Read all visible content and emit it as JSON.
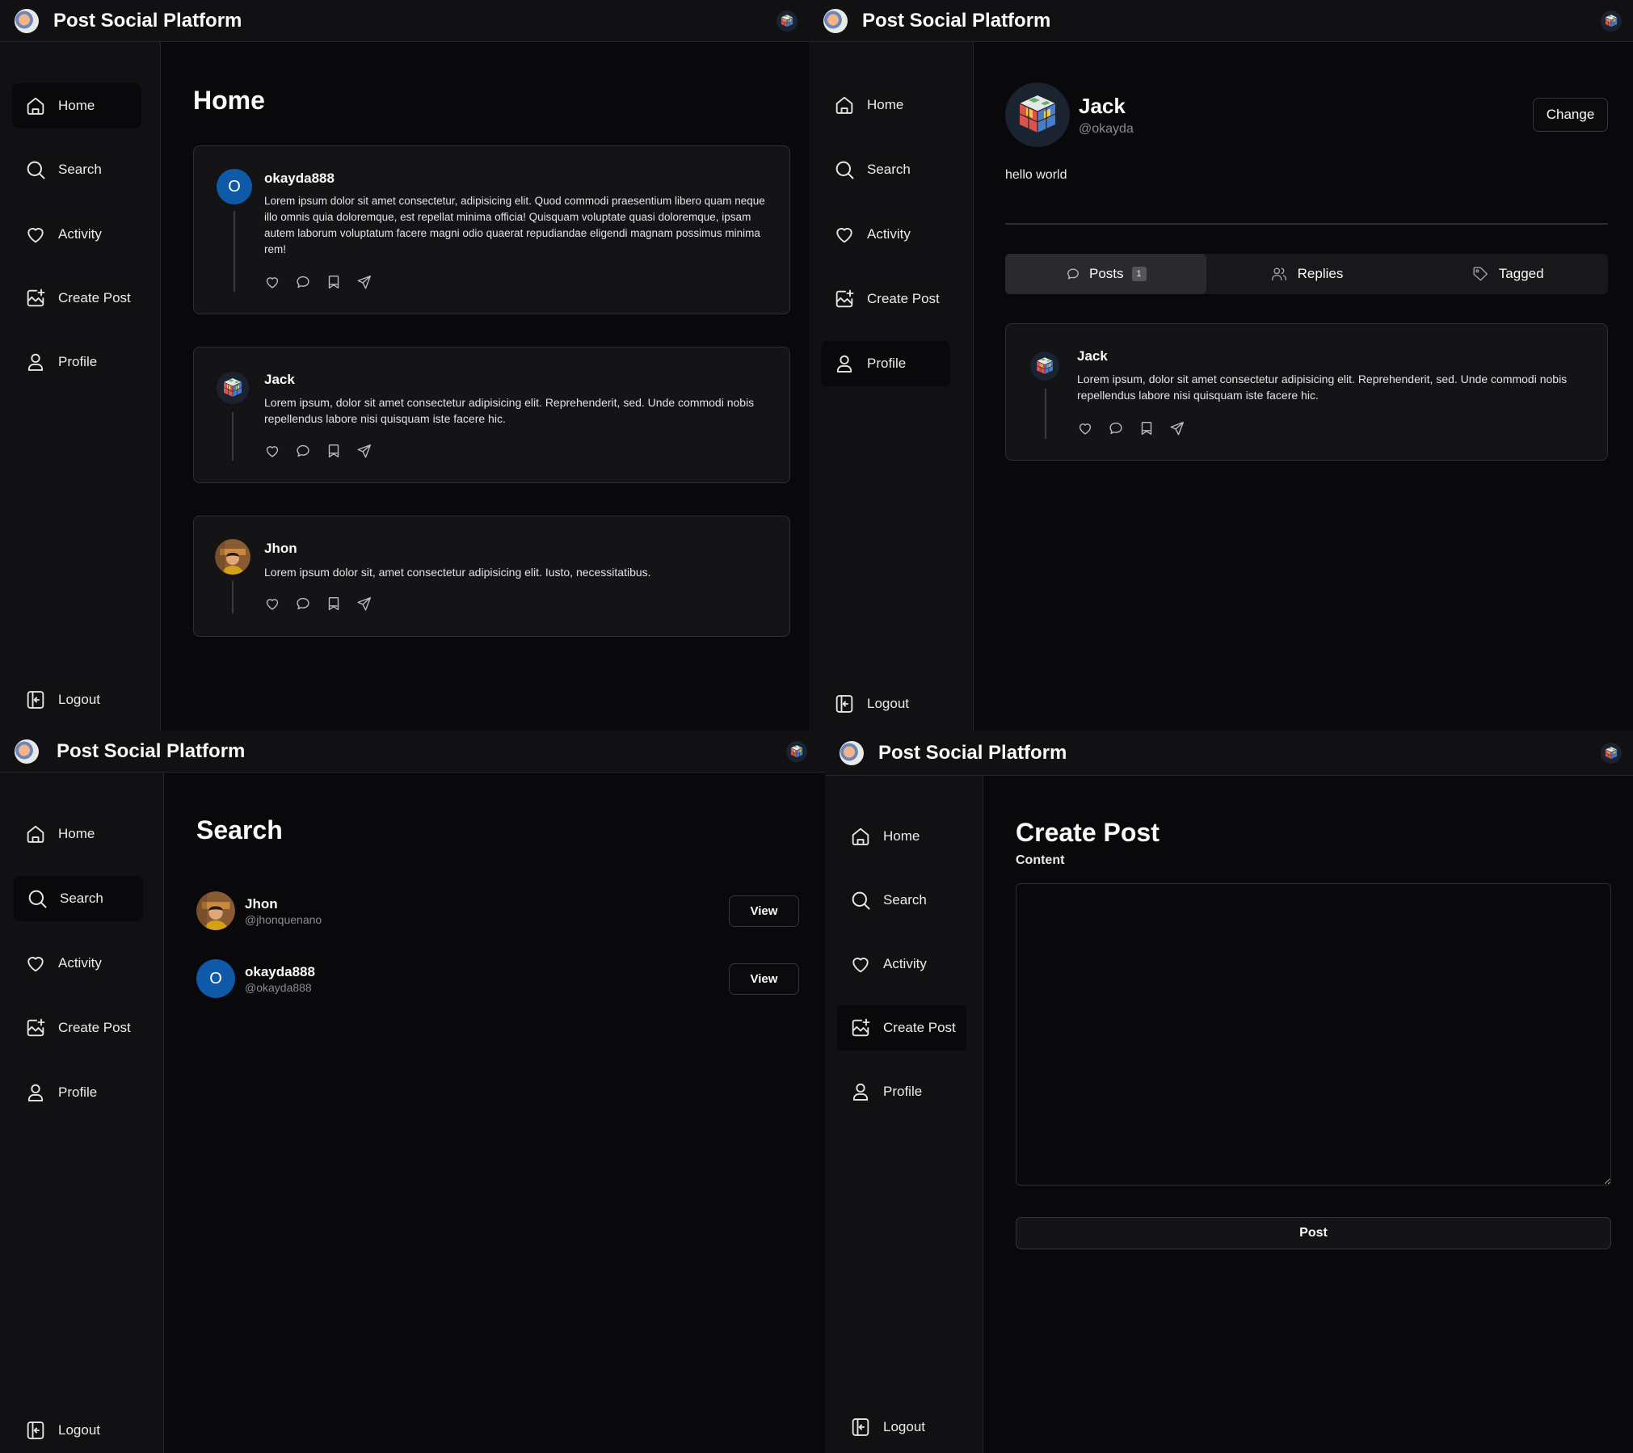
{
  "app": {
    "title": "Post Social Platform"
  },
  "nav": {
    "home": "Home",
    "search": "Search",
    "activity": "Activity",
    "create_post": "Create Post",
    "profile": "Profile",
    "logout": "Logout"
  },
  "home": {
    "title": "Home",
    "posts": [
      {
        "author": "okayda888",
        "initial": "O",
        "text": "Lorem ipsum dolor sit amet consectetur, adipisicing elit. Quod commodi praesentium libero quam neque illo omnis quia doloremque, est repellat minima officia! Quisquam voluptate quasi doloremque, ipsam autem laborum voluptatum facere magni odio quaerat repudiandae eligendi magnam possimus minima rem!"
      },
      {
        "author": "Jack",
        "text": "Lorem ipsum, dolor sit amet consectetur adipisicing elit. Reprehenderit, sed. Unde commodi nobis repellendus labore nisi quisquam iste facere hic."
      },
      {
        "author": "Jhon",
        "text": "Lorem ipsum dolor sit, amet consectetur adipisicing elit. Iusto, necessitatibus."
      }
    ]
  },
  "profile": {
    "name": "Jack",
    "handle": "@okayda",
    "bio": "hello world",
    "change_label": "Change",
    "tabs": {
      "posts": "Posts",
      "posts_count": "1",
      "replies": "Replies",
      "tagged": "Tagged"
    },
    "post": {
      "author": "Jack",
      "text": "Lorem ipsum, dolor sit amet consectetur adipisicing elit. Reprehenderit, sed. Unde commodi nobis repellendus labore nisi quisquam iste facere hic."
    }
  },
  "search": {
    "title": "Search",
    "results": [
      {
        "name": "Jhon",
        "handle": "@jhonquenano",
        "action": "View"
      },
      {
        "name": "okayda888",
        "handle": "@okayda888",
        "initial": "O",
        "action": "View"
      }
    ]
  },
  "create": {
    "title": "Create Post",
    "content_label": "Content",
    "post_button": "Post"
  },
  "colors": {
    "background": "#09090b",
    "sidebar": "#111113",
    "border": "#26262a",
    "avatar_blue": "#0e5aa8"
  }
}
